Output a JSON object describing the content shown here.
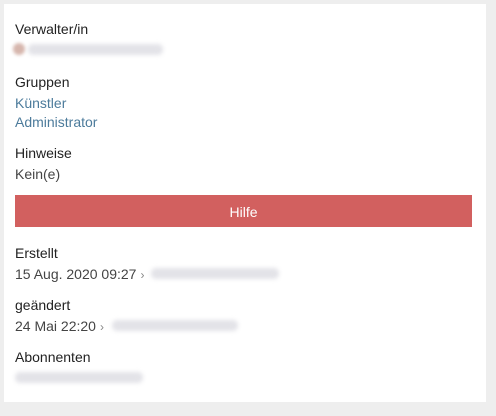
{
  "manager": {
    "label": "Verwalter/in"
  },
  "groups": {
    "label": "Gruppen",
    "items": [
      "Künstler",
      "Administrator"
    ]
  },
  "notes": {
    "label": "Hinweise",
    "value": "Kein(e)"
  },
  "help_button": {
    "label": "Hilfe",
    "color": "#d2605f"
  },
  "created": {
    "label": "Erstellt",
    "date": "15 Aug. 2020 09:27",
    "separator": "›"
  },
  "modified": {
    "label": "geändert",
    "date": "24 Mai 22:20",
    "separator": "›"
  },
  "subscribers": {
    "label": "Abonnenten"
  },
  "colors": {
    "link": "#4c7b9b",
    "panel_bg": "#ffffff",
    "page_bg": "#eeeeee"
  }
}
